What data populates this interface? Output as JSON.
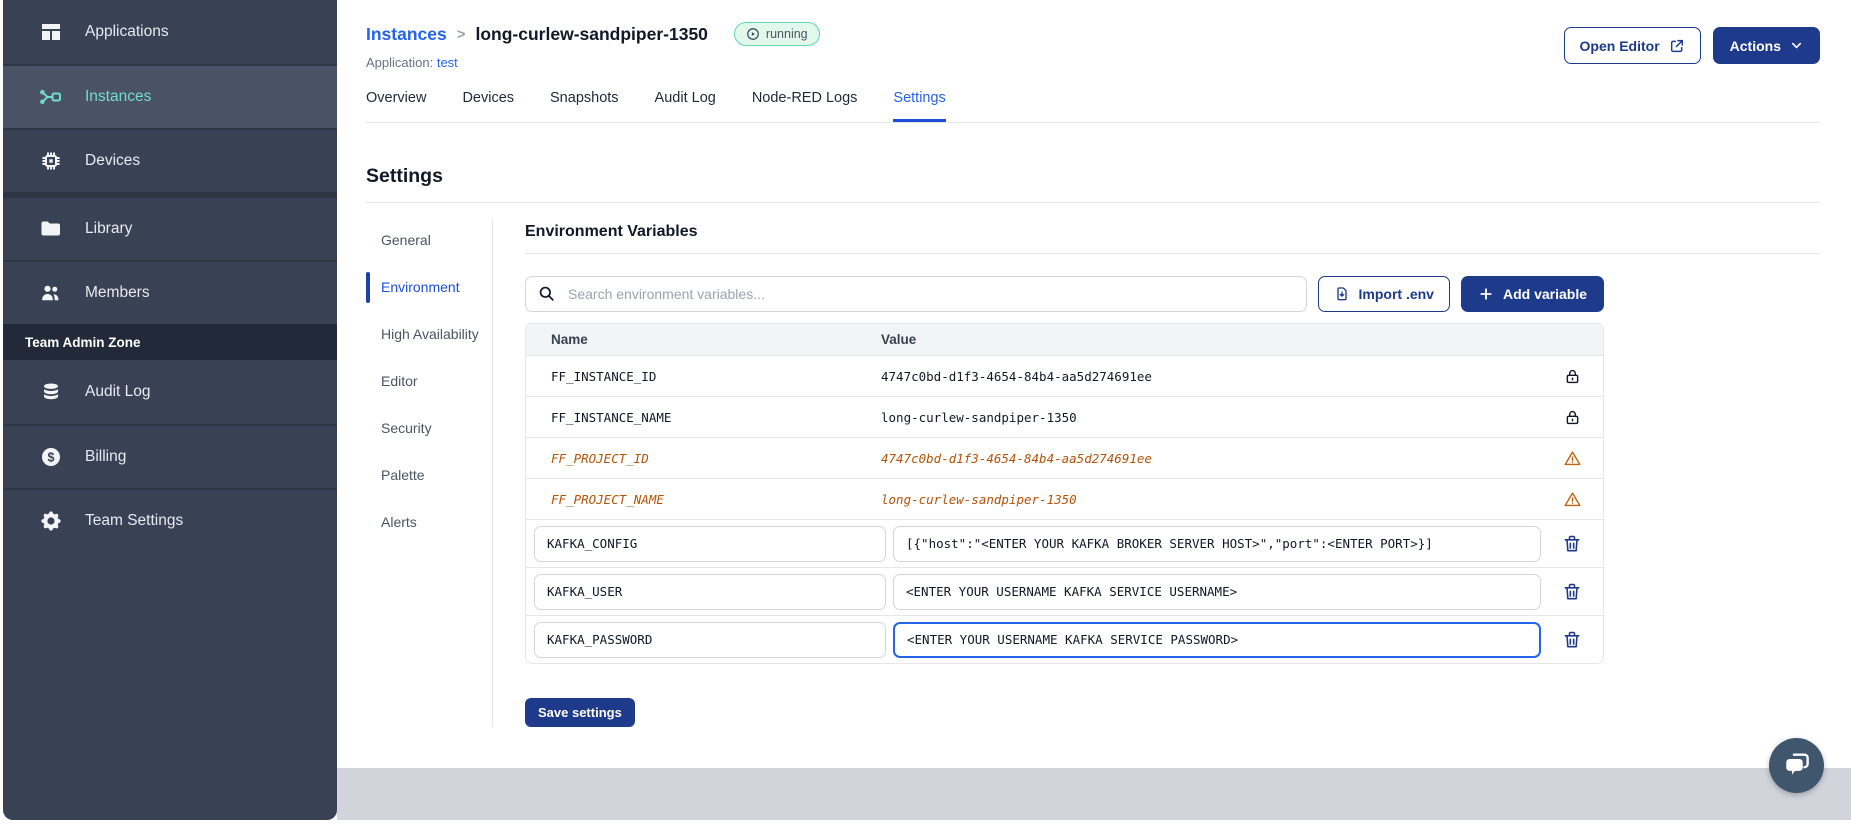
{
  "sidebar": {
    "items": [
      {
        "label": "Applications",
        "icon": "applications-icon",
        "active": false,
        "group": 1
      },
      {
        "label": "Instances",
        "icon": "instances-icon",
        "active": true,
        "group": 1
      },
      {
        "label": "Devices",
        "icon": "devices-icon",
        "active": false,
        "group": 1
      },
      {
        "label": "Library",
        "icon": "library-icon",
        "active": false,
        "group": 2
      },
      {
        "label": "Members",
        "icon": "members-icon",
        "active": false,
        "group": 2
      }
    ],
    "admin_zone_label": "Team Admin Zone",
    "admin_items": [
      {
        "label": "Audit Log",
        "icon": "audit-log-icon"
      },
      {
        "label": "Billing",
        "icon": "billing-icon"
      },
      {
        "label": "Team Settings",
        "icon": "team-settings-icon"
      }
    ]
  },
  "header": {
    "breadcrumb_root": "Instances",
    "breadcrumb_separator": ">",
    "instance_name": "long-curlew-sandpiper-1350",
    "status": "running",
    "status_icon": "play-circle-icon",
    "application_label": "Application:",
    "application_name": "test",
    "open_editor_label": "Open Editor",
    "actions_label": "Actions"
  },
  "tabs": [
    {
      "label": "Overview",
      "active": false
    },
    {
      "label": "Devices",
      "active": false
    },
    {
      "label": "Snapshots",
      "active": false
    },
    {
      "label": "Audit Log",
      "active": false
    },
    {
      "label": "Node-RED Logs",
      "active": false
    },
    {
      "label": "Settings",
      "active": true
    }
  ],
  "settings": {
    "title": "Settings",
    "nav": [
      {
        "label": "General",
        "active": false
      },
      {
        "label": "Environment",
        "active": true
      },
      {
        "label": "High Availability",
        "active": false
      },
      {
        "label": "Editor",
        "active": false
      },
      {
        "label": "Security",
        "active": false
      },
      {
        "label": "Palette",
        "active": false
      },
      {
        "label": "Alerts",
        "active": false
      }
    ]
  },
  "env": {
    "title": "Environment Variables",
    "search_placeholder": "Search environment variables...",
    "import_label": "Import .env",
    "add_label": "Add variable",
    "columns": {
      "name": "Name",
      "value": "Value"
    },
    "rows": [
      {
        "name": "FF_INSTANCE_ID",
        "value": "4747c0bd-d1f3-4654-84b4-aa5d274691ee",
        "state": "locked",
        "focused": false
      },
      {
        "name": "FF_INSTANCE_NAME",
        "value": "long-curlew-sandpiper-1350",
        "state": "locked",
        "focused": false
      },
      {
        "name": "FF_PROJECT_ID",
        "value": "4747c0bd-d1f3-4654-84b4-aa5d274691ee",
        "state": "deprecated",
        "focused": false
      },
      {
        "name": "FF_PROJECT_NAME",
        "value": "long-curlew-sandpiper-1350",
        "state": "deprecated",
        "focused": false
      },
      {
        "name": "KAFKA_CONFIG",
        "value": "[{\"host\":\"<ENTER YOUR KAFKA BROKER SERVER HOST>\",\"port\":<ENTER PORT>}]",
        "state": "editable",
        "focused": false
      },
      {
        "name": "KAFKA_USER",
        "value": "<ENTER YOUR USERNAME KAFKA SERVICE USERNAME>",
        "state": "editable",
        "focused": false
      },
      {
        "name": "KAFKA_PASSWORD",
        "value": "<ENTER YOUR USERNAME KAFKA SERVICE PASSWORD>",
        "state": "editable",
        "focused": true
      }
    ],
    "save_label": "Save settings"
  },
  "colors": {
    "primary_button": "#1e3a8a",
    "link_blue": "#2563eb",
    "active_tab_underline": "#1d4ed8",
    "sidebar_bg": "#394254",
    "sidebar_active_bg": "#4a5365",
    "sidebar_active_text": "#74dbd0",
    "admin_zone_bg": "#222938",
    "status_badge_bg": "#e2f8ec",
    "status_badge_border": "#5fd9a8",
    "deprecated_text": "#b45309",
    "footer_strip": "#d1d4db",
    "chat_fab_bg": "#3f566d"
  }
}
